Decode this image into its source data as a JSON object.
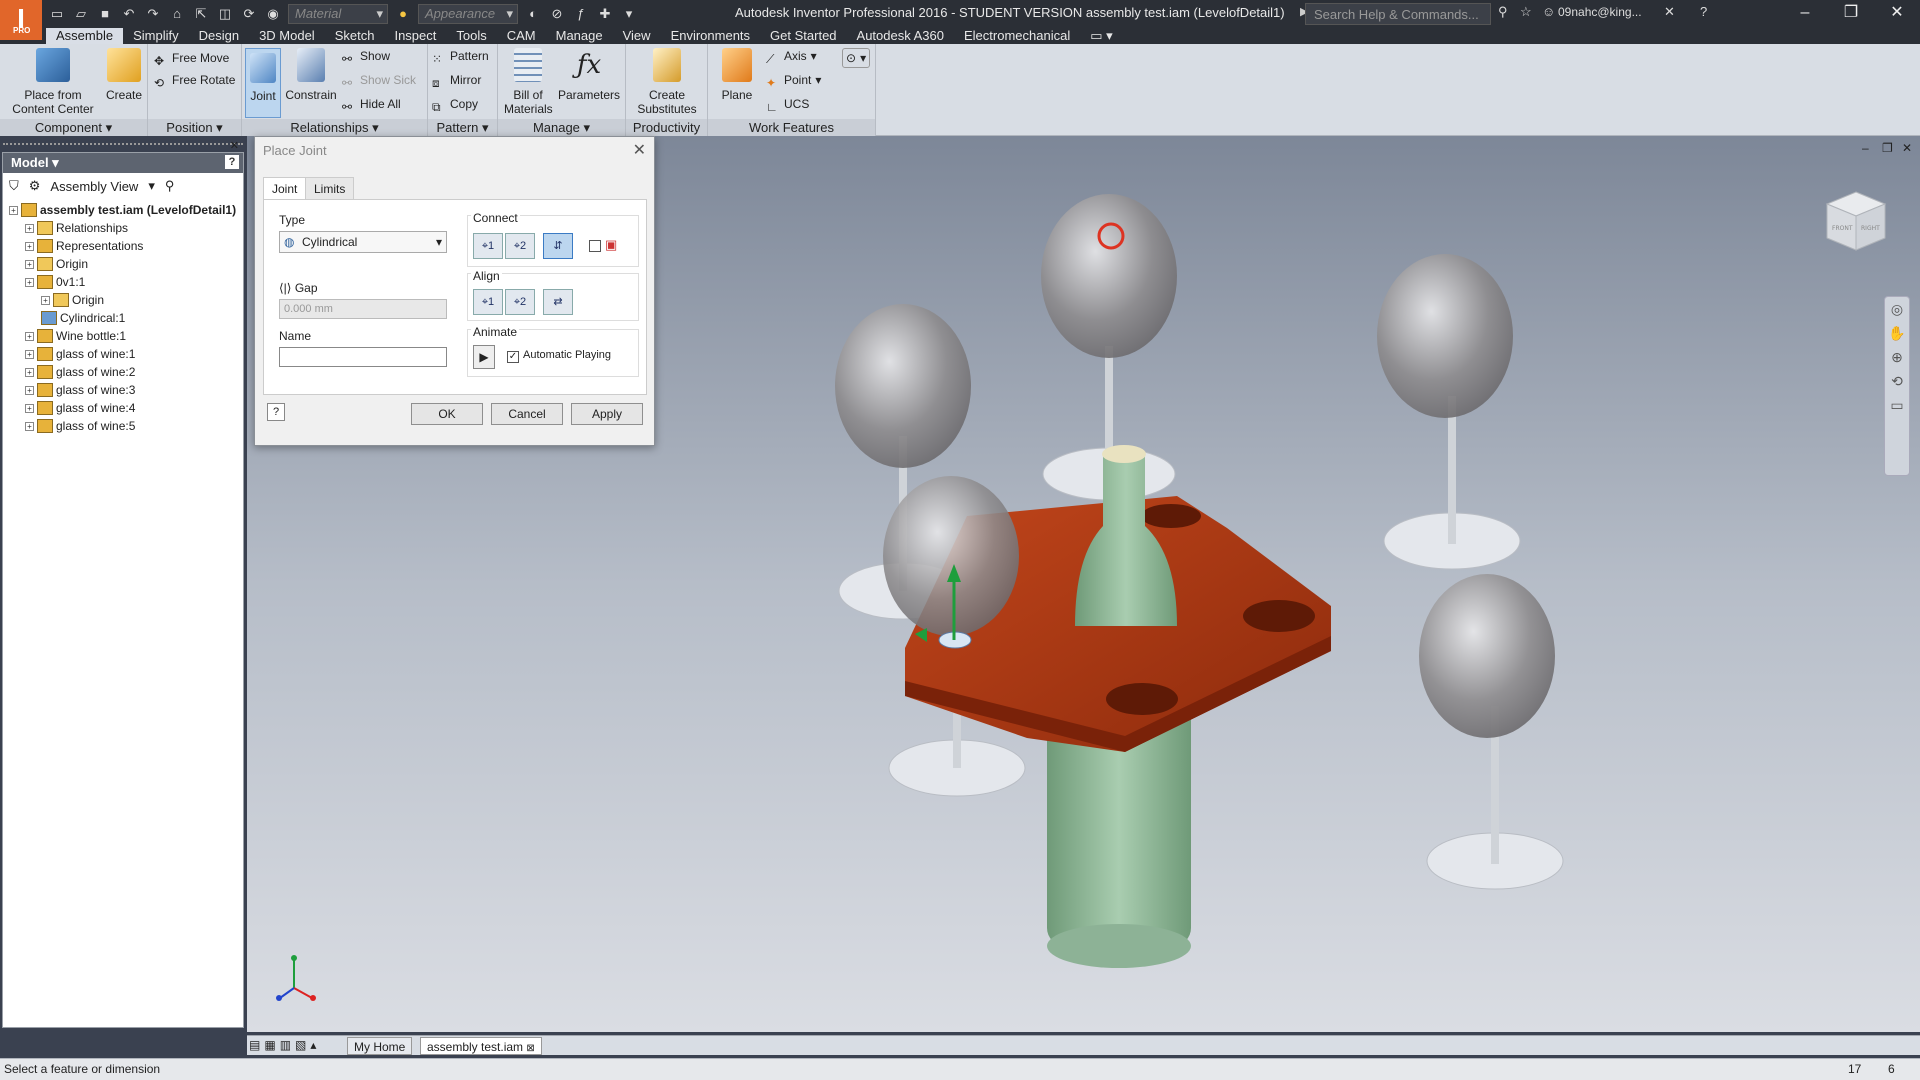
{
  "app": {
    "title": "Autodesk Inventor Professional 2016 - STUDENT VERSION    assembly test.iam (LevelofDetail1)",
    "logo_letter": "I",
    "logo_badge": "PRO",
    "material_select": "Material",
    "appearance_select": "Appearance",
    "search_placeholder": "Search Help & Commands...",
    "user": "09nahc@king...",
    "accent": "#e1662a"
  },
  "menu_tabs": [
    "Assemble",
    "Simplify",
    "Design",
    "3D Model",
    "Sketch",
    "Inspect",
    "Tools",
    "CAM",
    "Manage",
    "View",
    "Environments",
    "Get Started",
    "Autodesk A360",
    "Electromechanical"
  ],
  "ribbon": {
    "component": {
      "label": "Component",
      "place": "Place from\nContent Center",
      "create": "Create"
    },
    "position": {
      "label": "Position",
      "free_move": "Free Move",
      "free_rotate": "Free Rotate"
    },
    "relationships": {
      "label": "Relationships",
      "joint": "Joint",
      "constrain": "Constrain",
      "show": "Show",
      "show_sick": "Show Sick",
      "hide_all": "Hide All"
    },
    "pattern": {
      "label": "Pattern",
      "pattern": "Pattern",
      "mirror": "Mirror",
      "copy": "Copy"
    },
    "manage": {
      "label": "Manage",
      "bom": "Bill of\nMaterials",
      "parameters": "Parameters"
    },
    "productivity": {
      "label": "Productivity",
      "create_substitutes": "Create\nSubstitutes"
    },
    "work_features": {
      "label": "Work Features",
      "plane": "Plane",
      "axis": "Axis",
      "point": "Point",
      "ucs": "UCS"
    }
  },
  "browser": {
    "title": "Model",
    "view_select": "Assembly View",
    "nodes": [
      {
        "label": "assembly test.iam (LevelofDetail1)",
        "level": 0,
        "bold": true
      },
      {
        "label": "Relationships",
        "level": 1
      },
      {
        "label": "Representations",
        "level": 1
      },
      {
        "label": "Origin",
        "level": 1
      },
      {
        "label": "0v1:1",
        "level": 1
      },
      {
        "label": "Origin",
        "level": 2
      },
      {
        "label": "Cylindrical:1",
        "level": 2
      },
      {
        "label": "Wine bottle:1",
        "level": 1
      },
      {
        "label": "glass of wine:1",
        "level": 1
      },
      {
        "label": "glass of wine:2",
        "level": 1
      },
      {
        "label": "glass of wine:3",
        "level": 1
      },
      {
        "label": "glass of wine:4",
        "level": 1
      },
      {
        "label": "glass of wine:5",
        "level": 1
      }
    ]
  },
  "dialog": {
    "title": "Place Joint",
    "tabs": [
      "Joint",
      "Limits"
    ],
    "type_label": "Type",
    "type_value": "Cylindrical",
    "gap_label": "Gap",
    "gap_value": "0.000 mm",
    "name_label": "Name",
    "name_value": "",
    "connect_label": "Connect",
    "align_label": "Align",
    "animate_label": "Animate",
    "auto_playing": "Automatic Playing",
    "ok": "OK",
    "cancel": "Cancel",
    "apply": "Apply",
    "btn1": "1",
    "btn2": "2"
  },
  "doc_tabs": [
    "My Home",
    "assembly test.iam"
  ],
  "status": {
    "text": "Select a feature or dimension",
    "num1": "17",
    "num2": "6"
  },
  "viewcube": {
    "front": "FRONT",
    "right": "RIGHT"
  }
}
